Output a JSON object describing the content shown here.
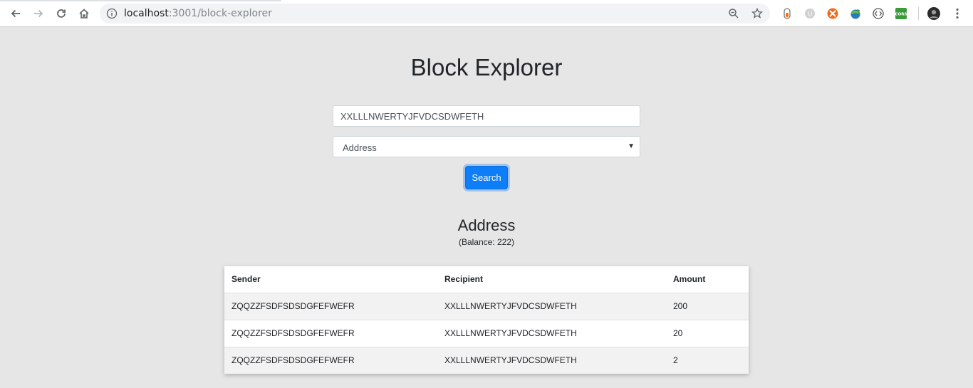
{
  "browser": {
    "url_host": "localhost",
    "url_port_path": ":3001/block-explorer"
  },
  "page": {
    "title": "Block Explorer",
    "search_value": "XXLLLNWERTYJFVDCSDWFETH",
    "select_value": "Address",
    "search_button": "Search"
  },
  "result": {
    "title": "Address",
    "balance_text": "(Balance: 222)"
  },
  "table": {
    "headers": [
      "Sender",
      "Recipient",
      "Amount"
    ],
    "rows": [
      {
        "sender": "ZQQZZFSDFSDSDGFEFWEFR",
        "recipient": "XXLLLNWERTYJFVDCSDWFETH",
        "amount": "200"
      },
      {
        "sender": "ZQQZZFSDFSDSDGFEFWEFR",
        "recipient": "XXLLLNWERTYJFVDCSDWFETH",
        "amount": "20"
      },
      {
        "sender": "ZQQZZFSDFSDSDGFEFWEFR",
        "recipient": "XXLLLNWERTYJFVDCSDWFETH",
        "amount": "2"
      }
    ]
  },
  "colors": {
    "accent": "#0d7ef7",
    "page_bg": "#e6e6e6"
  }
}
